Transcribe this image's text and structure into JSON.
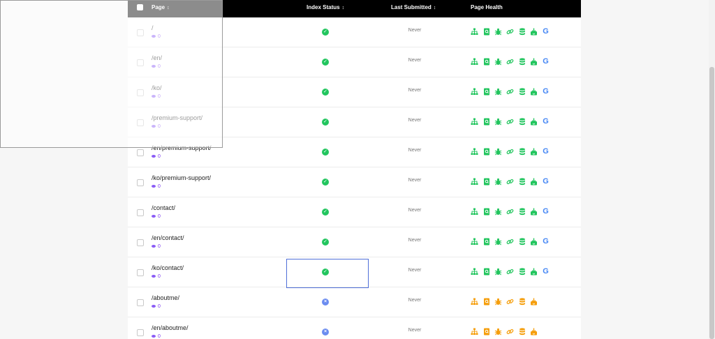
{
  "header": {
    "page_label": "Page",
    "index_status_label": "Index Status",
    "last_submitted_label": "Last Submitted",
    "page_health_label": "Page Health"
  },
  "colors": {
    "ok_green": "#22c55e",
    "warn_orange": "#f59e0b",
    "not_indexed_blue": "#6b8cf0",
    "views_purple": "#7c3aed"
  },
  "rows": [
    {
      "path": "/",
      "views": "0",
      "status": "indexed",
      "submitted": "Never",
      "health": "good"
    },
    {
      "path": "/en/",
      "views": "0",
      "status": "indexed",
      "submitted": "Never",
      "health": "good"
    },
    {
      "path": "/ko/",
      "views": "0",
      "status": "indexed",
      "submitted": "Never",
      "health": "good"
    },
    {
      "path": "/premium-support/",
      "views": "0",
      "status": "indexed",
      "submitted": "Never",
      "health": "good"
    },
    {
      "path": "/en/premium-support/",
      "views": "0",
      "status": "indexed",
      "submitted": "Never",
      "health": "good"
    },
    {
      "path": "/ko/premium-support/",
      "views": "0",
      "status": "indexed",
      "submitted": "Never",
      "health": "good"
    },
    {
      "path": "/contact/",
      "views": "0",
      "status": "indexed",
      "submitted": "Never",
      "health": "good"
    },
    {
      "path": "/en/contact/",
      "views": "0",
      "status": "indexed",
      "submitted": "Never",
      "health": "good"
    },
    {
      "path": "/ko/contact/",
      "views": "0",
      "status": "indexed",
      "submitted": "Never",
      "health": "good"
    },
    {
      "path": "/aboutme/",
      "views": "0",
      "status": "not-indexed",
      "submitted": "Never",
      "health": "warning"
    },
    {
      "path": "/en/aboutme/",
      "views": "0",
      "status": "not-indexed",
      "submitted": "Never",
      "health": "warning"
    }
  ],
  "health_icons": [
    "sitemap-icon",
    "page-search-icon",
    "bug-icon",
    "link-icon",
    "database-icon",
    "download-icon",
    "google-icon"
  ]
}
